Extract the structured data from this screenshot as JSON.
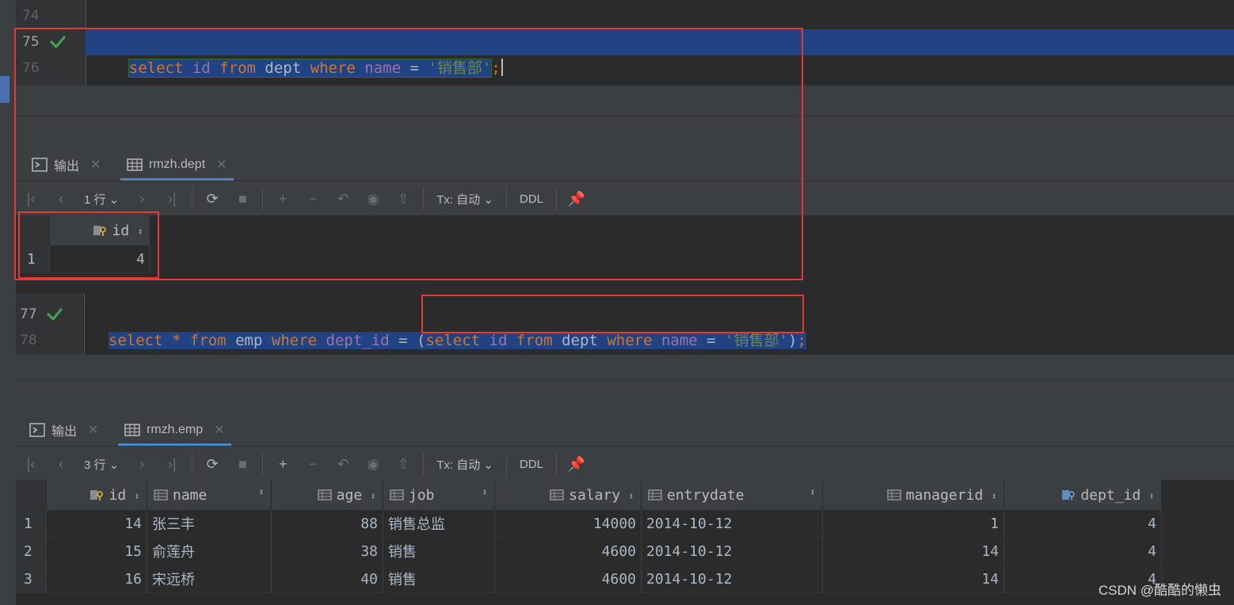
{
  "editor1": {
    "lines": [
      {
        "num": "74"
      },
      {
        "num": "75"
      },
      {
        "num": "76"
      }
    ],
    "query_tokens": {
      "select": "select",
      "id": "id",
      "from": "from",
      "dept": "dept",
      "where": "where",
      "name": "name",
      "eq": "=",
      "value": "'销售部'",
      "semi": ";"
    }
  },
  "panel1": {
    "tabs": [
      {
        "label": "输出"
      },
      {
        "label": "rmzh.dept"
      }
    ],
    "toolbar": {
      "rows": "1 行",
      "tx": "Tx: 自动",
      "ddl": "DDL"
    },
    "columns": [
      "id"
    ],
    "rows": [
      {
        "rownum": "1",
        "id": "4"
      }
    ]
  },
  "editor2": {
    "lines": [
      {
        "num": "77"
      },
      {
        "num": "78"
      }
    ],
    "query_tokens": {
      "select": "select",
      "star": "*",
      "from": "from",
      "emp": "emp",
      "where": "where",
      "dept_id": "dept_id",
      "eq": "=",
      "lparen": "(",
      "select2": "select",
      "id": "id",
      "from2": "from",
      "dept": "dept",
      "where2": "where",
      "name": "name",
      "eq2": "=",
      "value": "'销售部'",
      "rparen": ")",
      "semi": ";"
    }
  },
  "panel2": {
    "tabs": [
      {
        "label": "输出"
      },
      {
        "label": "rmzh.emp"
      }
    ],
    "toolbar": {
      "rows": "3 行",
      "tx": "Tx: 自动",
      "ddl": "DDL"
    },
    "columns": [
      "id",
      "name",
      "age",
      "job",
      "salary",
      "entrydate",
      "managerid",
      "dept_id"
    ],
    "rows": [
      {
        "rownum": "1",
        "id": "14",
        "name": "张三丰",
        "age": "88",
        "job": "销售总监",
        "salary": "14000",
        "entrydate": "2014-10-12",
        "managerid": "1",
        "dept_id": "4"
      },
      {
        "rownum": "2",
        "id": "15",
        "name": "俞莲舟",
        "age": "38",
        "job": "销售",
        "salary": "4600",
        "entrydate": "2014-10-12",
        "managerid": "14",
        "dept_id": "4"
      },
      {
        "rownum": "3",
        "id": "16",
        "name": "宋远桥",
        "age": "40",
        "job": "销售",
        "salary": "4600",
        "entrydate": "2014-10-12",
        "managerid": "14",
        "dept_id": "4"
      }
    ]
  },
  "watermark": "CSDN @酷酷的懒虫",
  "colors": {
    "keyword": "#cc7832",
    "identifier": "#9876aa",
    "string": "#6a8759",
    "selection": "#214283",
    "highlight_box": "#e53935"
  }
}
